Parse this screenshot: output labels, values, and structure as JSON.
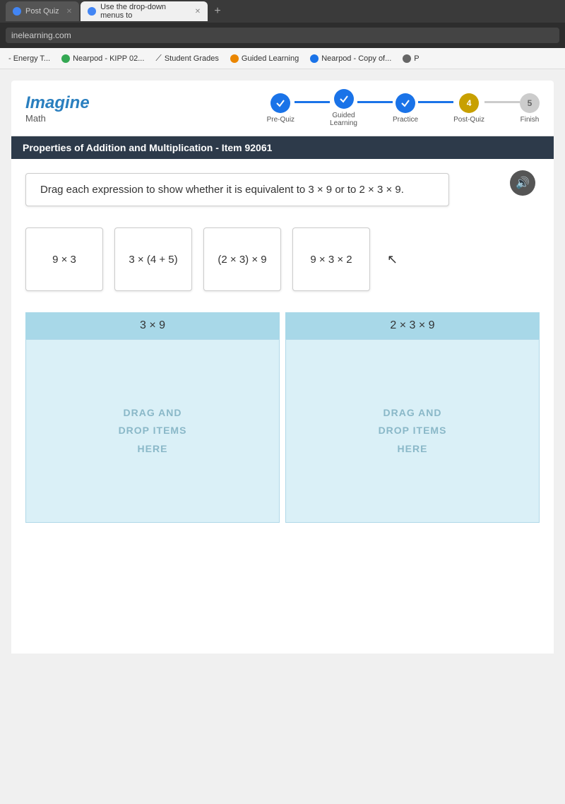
{
  "browser": {
    "tabs": [
      {
        "id": "tab1",
        "label": "Post Quiz",
        "active": false,
        "icon": "blue"
      },
      {
        "id": "tab2",
        "label": "Use the drop-down menus to",
        "active": false,
        "icon": "blue"
      }
    ],
    "address": "inelearning.com",
    "bookmarks": [
      {
        "id": "bk1",
        "label": "- Energy T...",
        "icon": "none"
      },
      {
        "id": "bk2",
        "label": "Nearpod - KIPP 02...",
        "icon": "green"
      },
      {
        "id": "bk3",
        "label": "Student Grades",
        "icon": "diagonal"
      },
      {
        "id": "bk4",
        "label": "Guided Learning",
        "icon": "orange"
      },
      {
        "id": "bk5",
        "label": "Nearpod - Copy of...",
        "icon": "blue2"
      },
      {
        "id": "bk6",
        "label": "P",
        "icon": "globe"
      }
    ]
  },
  "app": {
    "logo": "Imagine",
    "subject": "Math",
    "steps": [
      {
        "id": "s1",
        "label": "Pre-Quiz",
        "state": "completed",
        "symbol": "✓"
      },
      {
        "id": "s2",
        "label": "Guided\nLearning",
        "state": "completed",
        "symbol": "✓"
      },
      {
        "id": "s3",
        "label": "Practice",
        "state": "completed",
        "symbol": "✓"
      },
      {
        "id": "s4",
        "label": "Post-Quiz",
        "state": "active",
        "symbol": "4"
      },
      {
        "id": "s5",
        "label": "Finish",
        "state": "upcoming",
        "symbol": "5"
      }
    ],
    "item_title": "Properties of Addition and Multiplication - Item 92061",
    "instruction": "Drag each expression to show whether it is equivalent to 3 × 9 or to 2 × 3 × 9.",
    "drag_cards": [
      {
        "id": "dc1",
        "text": "9 × 3"
      },
      {
        "id": "dc2",
        "text": "3 × (4 + 5)"
      },
      {
        "id": "dc3",
        "text": "(2 × 3) × 9"
      },
      {
        "id": "dc4",
        "text": "9 × 3 × 2"
      }
    ],
    "drop_zones": [
      {
        "id": "dz1",
        "header": "3 × 9",
        "hint": "DRAG AND\nDROP ITEMS\nHERE"
      },
      {
        "id": "dz2",
        "header": "2 × 3 × 9",
        "hint": "DRAG AND\nDROP ITEMS\nHERE"
      }
    ]
  }
}
